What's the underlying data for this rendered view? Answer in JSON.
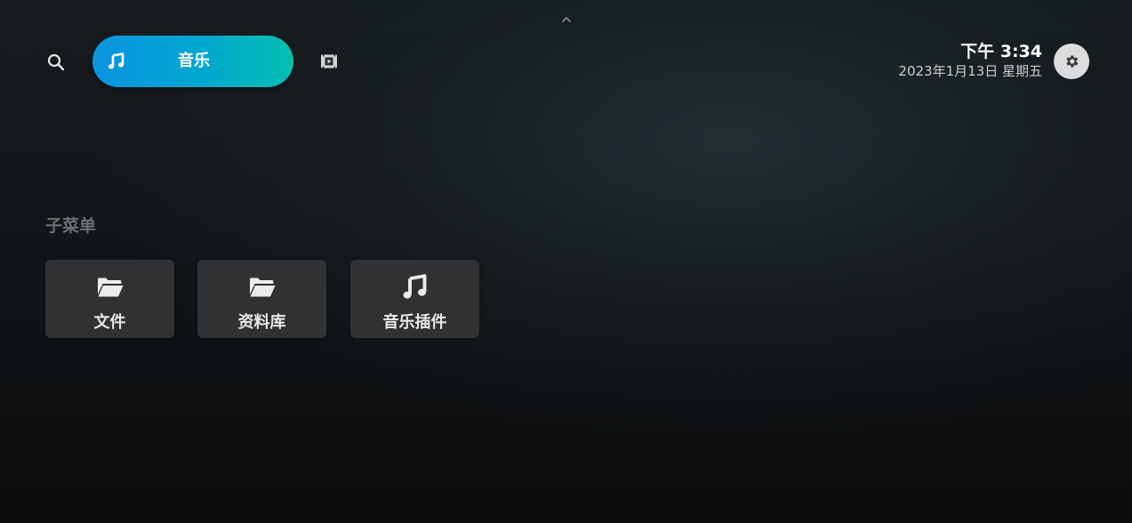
{
  "top_nav": {
    "search_icon": "search-icon",
    "tabs": [
      {
        "label": "音乐",
        "icon": "music-note-icon",
        "selected": true
      },
      {
        "label": "",
        "icon": "video-icon",
        "selected": false
      }
    ],
    "scroll_hint_icon": "chevron-up-icon"
  },
  "clock": {
    "time": "下午 3:34",
    "date": "2023年1月13日 星期五"
  },
  "settings": {
    "icon": "gear-icon"
  },
  "submenu": {
    "title": "子菜单",
    "items": [
      {
        "label": "文件",
        "icon": "folder-open-icon"
      },
      {
        "label": "资料库",
        "icon": "folder-open-icon"
      },
      {
        "label": "音乐插件",
        "icon": "music-note-icon"
      }
    ]
  },
  "colors": {
    "tab_gradient_start": "#0a93e0",
    "tab_gradient_end": "#04bfb0",
    "card_background": "#2f3133",
    "settings_button": "#dcdcdc"
  }
}
